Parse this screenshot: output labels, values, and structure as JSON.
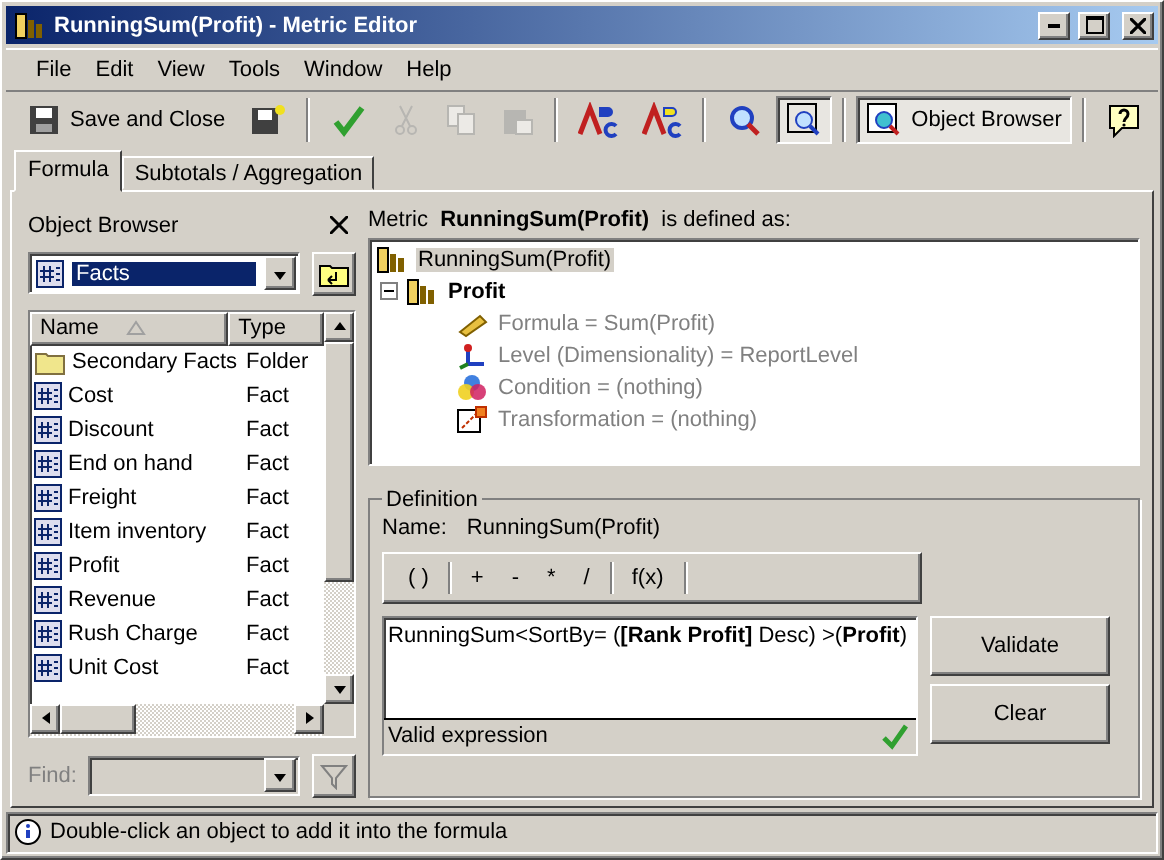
{
  "window": {
    "title": "RunningSum(Profit) - Metric Editor"
  },
  "menu": [
    "File",
    "Edit",
    "View",
    "Tools",
    "Window",
    "Help"
  ],
  "toolbar": [
    {
      "kind": "save",
      "label": "Save and Close",
      "disabled": false,
      "pressed": false
    },
    {
      "kind": "saveas",
      "disabled": false,
      "pressed": false
    },
    {
      "kind": "validate",
      "disabled": false,
      "pressed": false
    },
    {
      "kind": "cut",
      "disabled": true,
      "pressed": false
    },
    {
      "kind": "copy",
      "disabled": true,
      "pressed": false
    },
    {
      "kind": "paste",
      "disabled": true,
      "pressed": false
    },
    {
      "kind": "spell",
      "disabled": false,
      "pressed": false
    },
    {
      "kind": "spell2",
      "disabled": false,
      "pressed": false
    },
    {
      "kind": "find",
      "disabled": false,
      "pressed": false
    },
    {
      "kind": "zoom",
      "disabled": false,
      "pressed": true
    },
    {
      "kind": "browser",
      "label": "Object Browser",
      "disabled": false,
      "pressed": true
    },
    {
      "kind": "help",
      "disabled": false,
      "pressed": false
    }
  ],
  "tabs": [
    {
      "label": "Formula",
      "selected": true
    },
    {
      "label": "Subtotals / Aggregation",
      "selected": false
    }
  ],
  "object_browser": {
    "title": "Object Browser",
    "folder": "Facts",
    "columns": [
      "Name",
      "Type"
    ],
    "rows": [
      {
        "kind": "folder",
        "name": "Secondary Facts",
        "type": "Folder"
      },
      {
        "kind": "fact",
        "name": "Cost",
        "type": "Fact"
      },
      {
        "kind": "fact",
        "name": "Discount",
        "type": "Fact"
      },
      {
        "kind": "fact",
        "name": "End on hand",
        "type": "Fact"
      },
      {
        "kind": "fact",
        "name": "Freight",
        "type": "Fact"
      },
      {
        "kind": "fact",
        "name": "Item inventory",
        "type": "Fact"
      },
      {
        "kind": "fact",
        "name": "Profit",
        "type": "Fact"
      },
      {
        "kind": "fact",
        "name": "Revenue",
        "type": "Fact"
      },
      {
        "kind": "fact",
        "name": "Rush Charge",
        "type": "Fact"
      },
      {
        "kind": "fact",
        "name": "Unit Cost",
        "type": "Fact"
      }
    ],
    "find_label": "Find:"
  },
  "heading": "Metric  **RunningSum(Profit)**  is defined as:",
  "tree": [
    {
      "label": "RunningSum(Profit)",
      "kind": "metric",
      "selected": true,
      "bold": false
    },
    {
      "label": "Profit",
      "kind": "metric",
      "selected": false,
      "bold": true,
      "expanded": true,
      "children": [
        {
          "label": "Formula = Sum(Profit)",
          "kind": "formula",
          "selected": false,
          "bold": false
        },
        {
          "label": "Level (Dimensionality) = ReportLevel",
          "kind": "level",
          "selected": false,
          "bold": false
        },
        {
          "label": "Condition = (nothing)",
          "kind": "condition",
          "selected": false,
          "bold": false
        },
        {
          "label": "Transformation = (nothing)",
          "kind": "transformation",
          "selected": false,
          "bold": false
        }
      ]
    }
  ],
  "definition": {
    "legend": "Definition",
    "name_label": "Name:",
    "name": "RunningSum(Profit)",
    "operators": [
      [
        "( )"
      ],
      [
        "+",
        "-",
        "*",
        "/"
      ],
      [
        "f(x)"
      ]
    ],
    "formula": "RunningSum<SortBy= (**[Rank Profit]** Desc) >(**Profit**)",
    "validation": "Valid expression",
    "valid": true,
    "buttons": [
      "Validate",
      "Clear"
    ]
  },
  "status_bar": "Double-click an object to add it into the formula"
}
